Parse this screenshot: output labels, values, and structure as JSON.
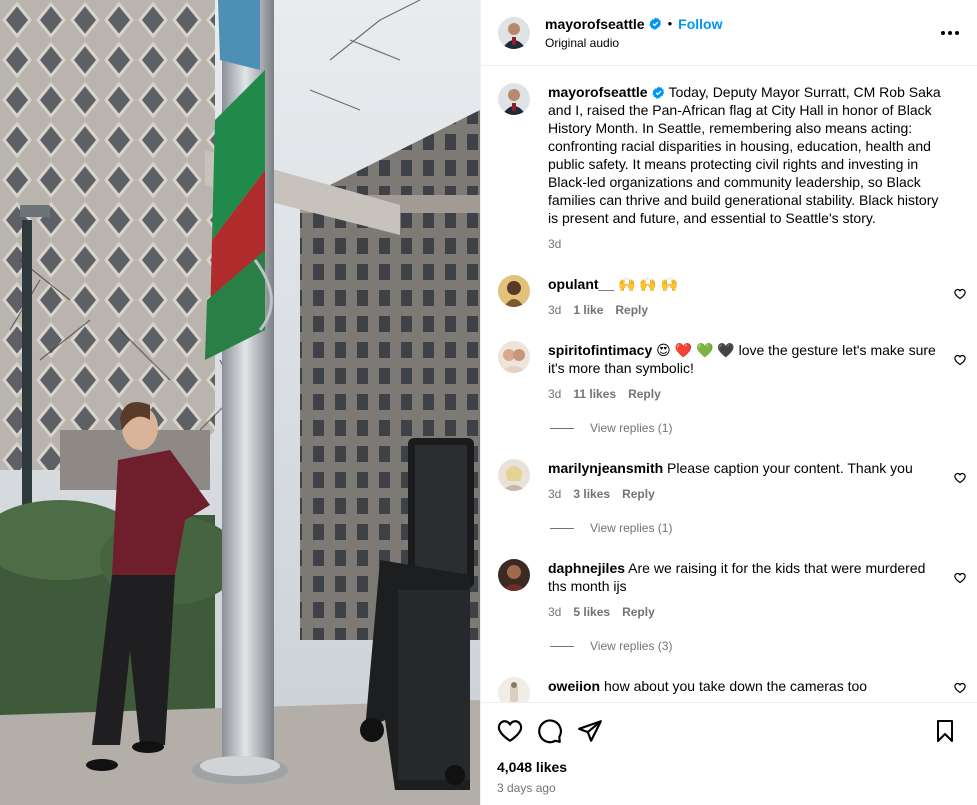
{
  "post": {
    "username": "mayorofseattle",
    "follow_label": "Follow",
    "dot": "•",
    "audio": "Original audio"
  },
  "caption": {
    "username": "mayorofseattle",
    "text": "Today, Deputy Mayor Surratt, CM Rob Saka and I, raised the Pan-African flag at City Hall in honor of Black History Month. In Seattle, remembering also means acting: confronting racial disparities in housing, education, health and public safety. It means protecting civil rights and investing in Black-led organizations and community leadership, so Black families can thrive and build generational stability. Black history is present and future, and essential to Seattle's story.",
    "time": "3d"
  },
  "comments": [
    {
      "username": "opulant__",
      "text": "🙌 🙌 🙌",
      "time": "3d",
      "likes": "1 like",
      "reply": "Reply",
      "replies": ""
    },
    {
      "username": "spiritofintimacy",
      "text": "😍 ❤️ 💚 🖤 love the gesture let's make sure it's more than symbolic!",
      "time": "3d",
      "likes": "11 likes",
      "reply": "Reply",
      "replies": "View replies (1)"
    },
    {
      "username": "marilynjeansmith",
      "text": "Please caption your content. Thank you",
      "time": "3d",
      "likes": "3 likes",
      "reply": "Reply",
      "replies": "View replies (1)"
    },
    {
      "username": "daphnejiles",
      "text": "Are we raising it for the kids that were murdered ths month ijs",
      "time": "3d",
      "likes": "5 likes",
      "reply": "Reply",
      "replies": "View replies (3)"
    },
    {
      "username": "oweiion",
      "text": "how about you take down the cameras too",
      "time": "",
      "likes": "",
      "reply": "",
      "replies": ""
    }
  ],
  "footer": {
    "likes": "4,048 likes",
    "time": "3 days ago"
  },
  "colors": {
    "link_blue": "#0095f6",
    "meta_gray": "#737373",
    "border": "#efefef"
  },
  "icons": [
    "verified-badge-icon",
    "more-options-icon",
    "heart-icon",
    "comment-icon",
    "share-icon",
    "bookmark-icon"
  ]
}
